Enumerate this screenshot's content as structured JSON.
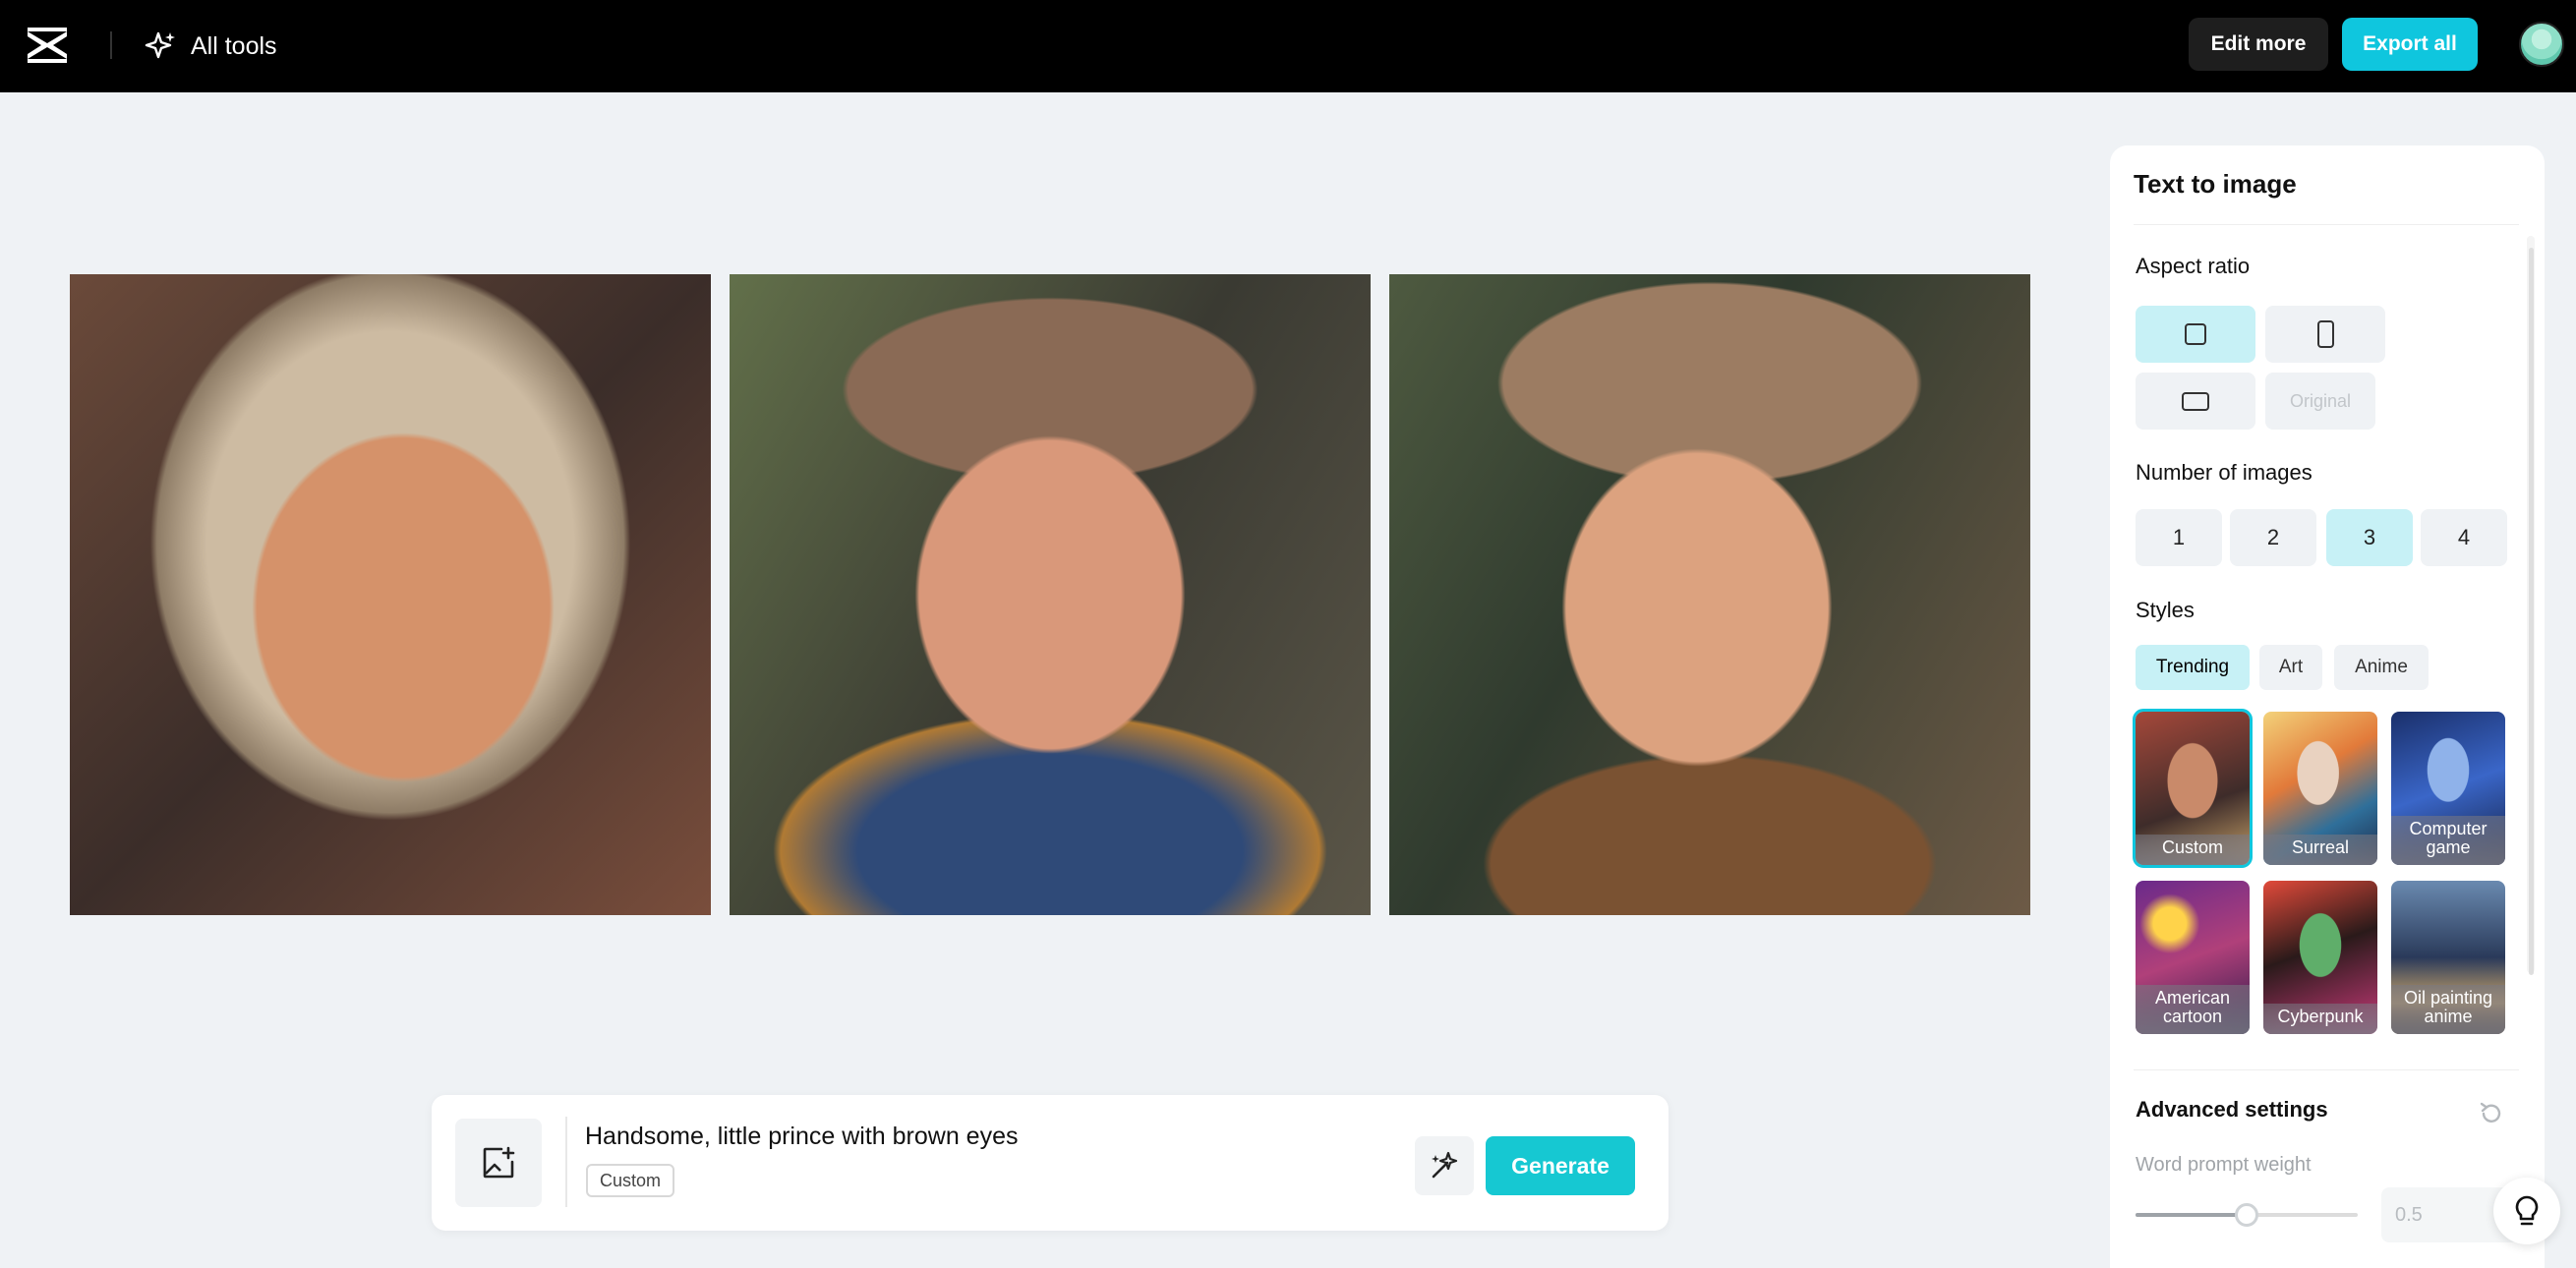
{
  "header": {
    "all_tools_label": "All tools",
    "edit_more_label": "Edit more",
    "export_all_label": "Export all"
  },
  "prompt": {
    "text": "Handsome, little prince with brown eyes",
    "style_tag": "Custom",
    "generate_label": "Generate"
  },
  "panel": {
    "title": "Text to image",
    "aspect_ratio": {
      "label": "Aspect ratio",
      "options": [
        "square",
        "portrait",
        "landscape",
        "Original"
      ],
      "selected": "square"
    },
    "number_of_images": {
      "label": "Number of images",
      "options": [
        "1",
        "2",
        "3",
        "4"
      ],
      "selected": "3"
    },
    "styles": {
      "label": "Styles",
      "tabs": [
        "Trending",
        "Art",
        "Anime"
      ],
      "selected_tab": "Trending",
      "cards": [
        "Custom",
        "Surreal",
        "Computer game",
        "American cartoon",
        "Cyberpunk",
        "Oil painting anime"
      ],
      "selected_card": "Custom"
    },
    "advanced": {
      "label": "Advanced settings",
      "word_prompt_weight_label": "Word prompt weight",
      "word_prompt_weight_value": "0.5",
      "slider_fraction": 0.5
    }
  },
  "colors": {
    "accent": "#0fc6de",
    "selected_bg": "#c7f1f6",
    "topbar": "#000000",
    "canvas_bg": "#eff2f5"
  },
  "icons": [
    "capcut-logo-icon",
    "sparkle-icon",
    "avatar",
    "image-upload-icon",
    "magic-wand-icon",
    "reset-icon",
    "lightbulb-icon"
  ]
}
